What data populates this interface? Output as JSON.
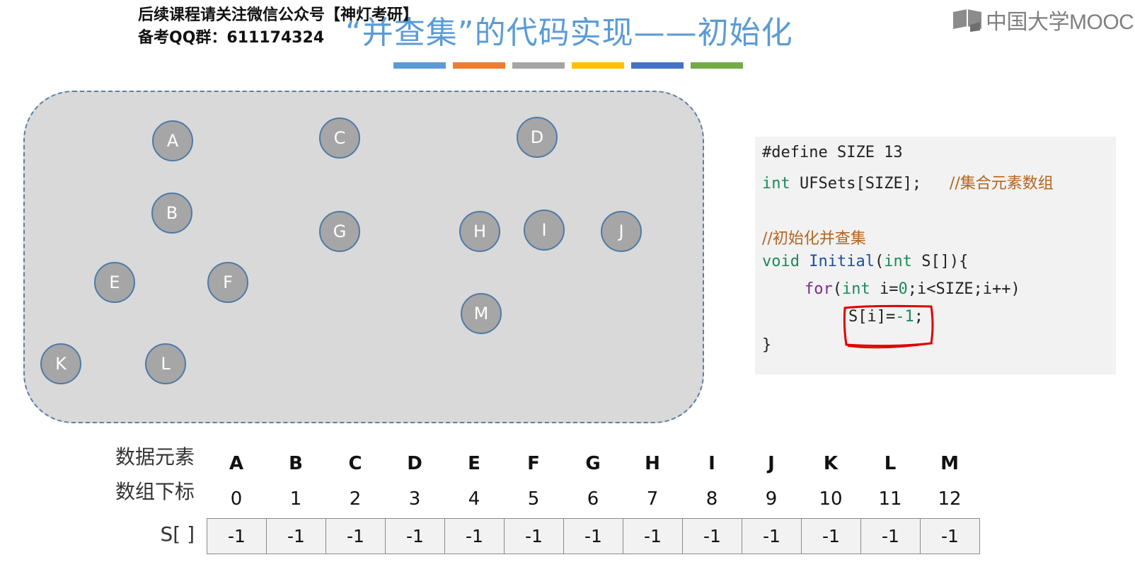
{
  "watermark": {
    "line1": "后续课程请关注微信公众号【神灯考研】",
    "line2": "备考QQ群：611174324"
  },
  "title": "“并查集”的代码实现——初始化",
  "logo": {
    "text": "中国大学MOOC",
    "icon": "mooc-book-icon"
  },
  "colors": {
    "strip": [
      "#5b9bd5",
      "#ed7d31",
      "#a5a5a5",
      "#ffc000",
      "#4472c4",
      "#70ad47"
    ],
    "panel": "#d9d9d9",
    "node": "#a6a6a6",
    "node_border": "#4f7aa6",
    "highlight": "#e00000"
  },
  "nodes": [
    "A",
    "B",
    "C",
    "D",
    "E",
    "F",
    "G",
    "H",
    "I",
    "J",
    "K",
    "L",
    "M"
  ],
  "code": {
    "line1": {
      "text": "#define SIZE 13"
    },
    "line2": {
      "kw": "int",
      "rest": " UFSets[SIZE];   ",
      "comment": "//集合元素数组"
    },
    "line4": {
      "comment": "//初始化并查集"
    },
    "line5": {
      "kw": "void",
      "fn": "Initial",
      "p1": "(",
      "kw2": "int",
      "p2": " S[]){"
    },
    "line6": {
      "kw_for": "for",
      "p1": "(",
      "kw": "int",
      "p2": " i=",
      "n": "0",
      "p3": ";i<SIZE;i++)"
    },
    "line7": {
      "p1": "S[i]=",
      "n": "-1",
      "p2": ";"
    },
    "line8": {
      "text": "}"
    }
  },
  "table": {
    "row1_label": "数据元素",
    "row2_label": "数组下标",
    "row3_label": "S[ ]",
    "elements": [
      "A",
      "B",
      "C",
      "D",
      "E",
      "F",
      "G",
      "H",
      "I",
      "J",
      "K",
      "L",
      "M"
    ],
    "indices": [
      "0",
      "1",
      "2",
      "3",
      "4",
      "5",
      "6",
      "7",
      "8",
      "9",
      "10",
      "11",
      "12"
    ],
    "values": [
      "-1",
      "-1",
      "-1",
      "-1",
      "-1",
      "-1",
      "-1",
      "-1",
      "-1",
      "-1",
      "-1",
      "-1",
      "-1"
    ]
  }
}
